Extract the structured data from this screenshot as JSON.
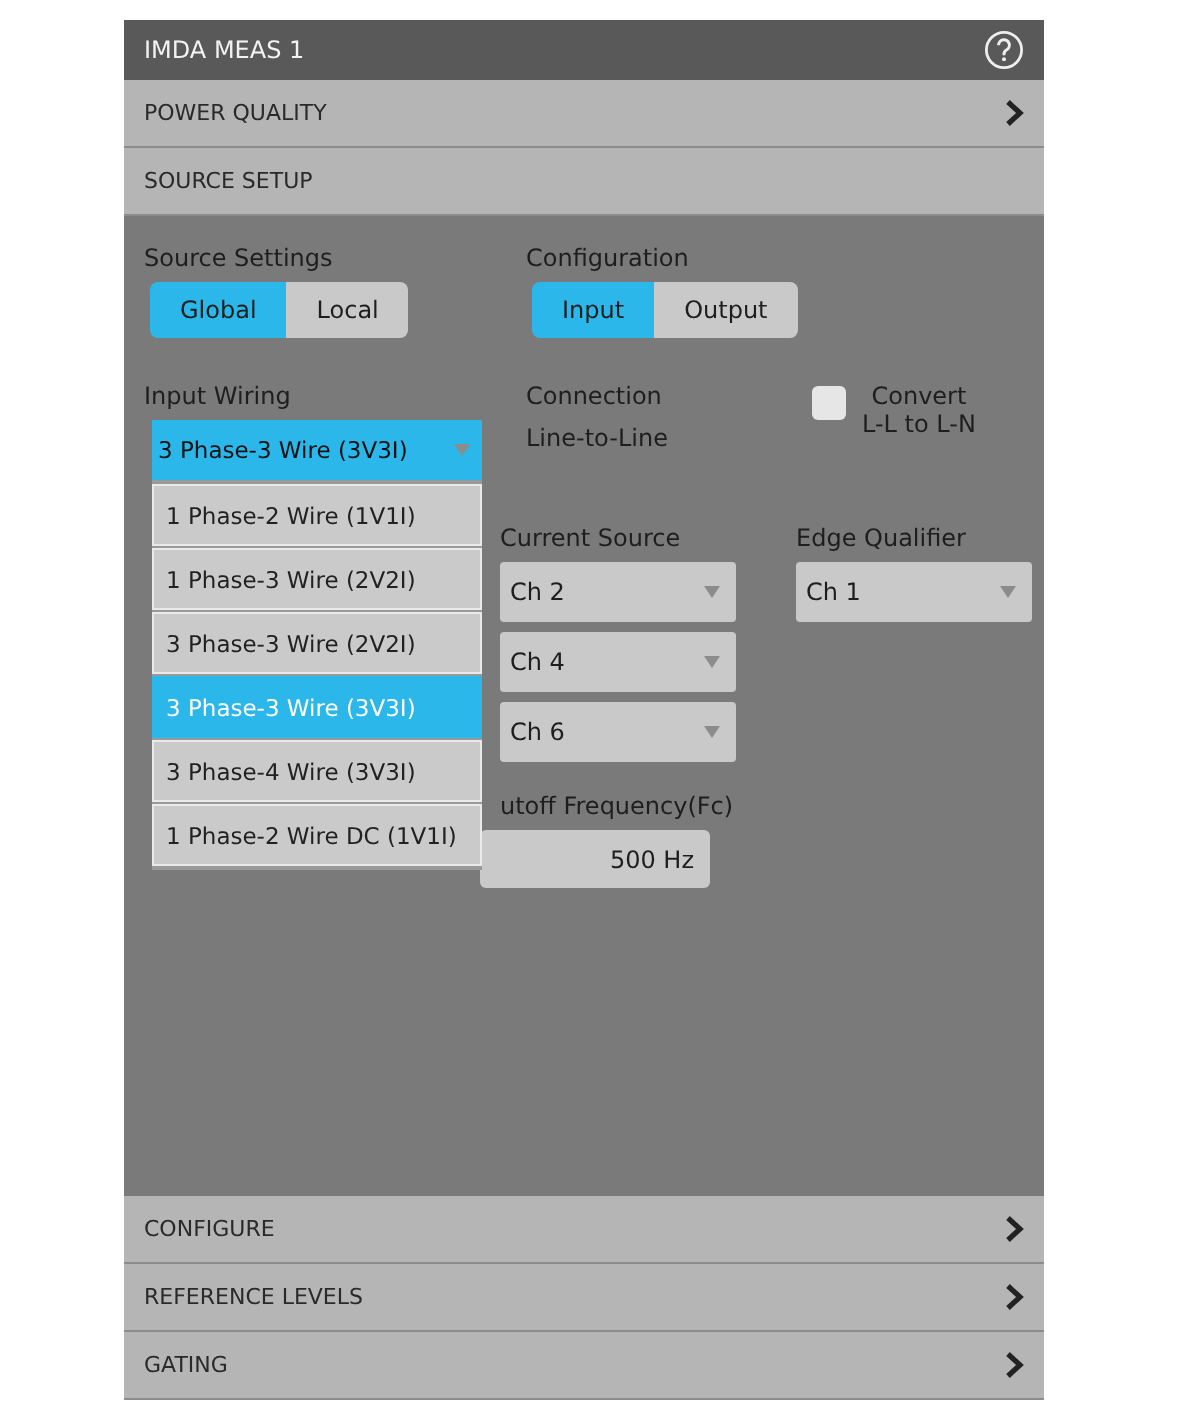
{
  "panel": {
    "title": "IMDA MEAS 1"
  },
  "sections_top": [
    {
      "label": "POWER QUALITY",
      "expanded": false
    },
    {
      "label": "SOURCE SETUP",
      "expanded": true
    }
  ],
  "source_settings": {
    "label": "Source Settings",
    "options": [
      {
        "label": "Global",
        "selected": true
      },
      {
        "label": "Local",
        "selected": false
      }
    ]
  },
  "configuration": {
    "label": "Configuration",
    "options": [
      {
        "label": "Input",
        "selected": true
      },
      {
        "label": "Output",
        "selected": false
      }
    ]
  },
  "input_wiring": {
    "label": "Input Wiring",
    "value": "3 Phase-3 Wire (3V3I)",
    "options": [
      {
        "label": "1 Phase-2 Wire (1V1I)",
        "selected": false
      },
      {
        "label": "1 Phase-3 Wire (2V2I)",
        "selected": false
      },
      {
        "label": "3 Phase-3 Wire (2V2I)",
        "selected": false
      },
      {
        "label": "3 Phase-3 Wire (3V3I)",
        "selected": true
      },
      {
        "label": "3 Phase-4 Wire (3V3I)",
        "selected": false
      },
      {
        "label": "1 Phase-2 Wire DC (1V1I)",
        "selected": false
      }
    ]
  },
  "connection": {
    "label": "Connection",
    "value": "Line-to-Line"
  },
  "convert": {
    "label_lines": [
      "Convert",
      "L-L to L-N"
    ],
    "checked": false
  },
  "current_source": {
    "label": "Current Source",
    "rows": [
      {
        "value": "Ch 2"
      },
      {
        "value": "Ch 4"
      },
      {
        "value": "Ch 6"
      }
    ]
  },
  "edge_qualifier": {
    "label": "Edge Qualifier",
    "value": "Ch 1"
  },
  "cutoff": {
    "label": "utoff Frequency(Fc)",
    "value": "500 Hz"
  },
  "sections_bottom": [
    {
      "label": "CONFIGURE",
      "expanded": false
    },
    {
      "label": "REFERENCE LEVELS",
      "expanded": false
    },
    {
      "label": "GATING",
      "expanded": false
    }
  ]
}
